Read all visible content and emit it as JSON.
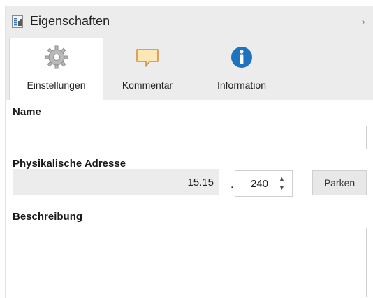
{
  "panel": {
    "title": "Eigenschaften",
    "header_icon": "properties-icon",
    "collapse_icon": "chevron-right-icon",
    "collapse_glyph": "›"
  },
  "tabs": [
    {
      "label": "Einstellungen",
      "icon": "gear-icon",
      "active": true
    },
    {
      "label": "Kommentar",
      "icon": "comment-icon",
      "active": false
    },
    {
      "label": "Information",
      "icon": "info-icon",
      "active": false
    }
  ],
  "form": {
    "name_label": "Name",
    "name_value": "",
    "address_label": "Physikalische Adresse",
    "address_value": "15.15",
    "address_separator": ".",
    "device_number": "240",
    "park_button": "Parken",
    "description_label": "Beschreibung",
    "description_value": ""
  },
  "colors": {
    "header_bg": "#ececec",
    "info_blue": "#1e73be",
    "comment_fill": "#fde7b6",
    "comment_stroke": "#d58a32"
  }
}
